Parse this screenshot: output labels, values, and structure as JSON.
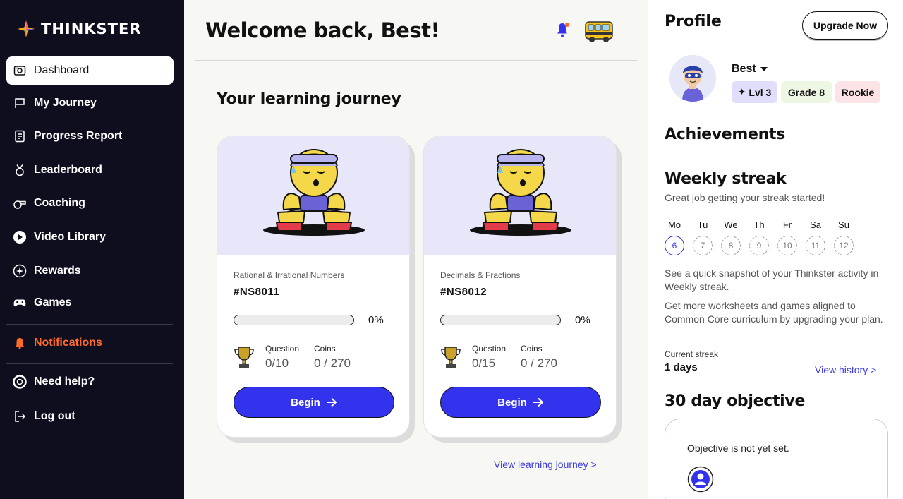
{
  "brand": {
    "name": "THINKSTER"
  },
  "sidebar": {
    "items": [
      {
        "label": "Dashboard",
        "icon": "dashboard-icon",
        "active": true
      },
      {
        "label": "My Journey",
        "icon": "flag-icon"
      },
      {
        "label": "Progress Report",
        "icon": "report-icon"
      },
      {
        "label": "Leaderboard",
        "icon": "medal-icon"
      },
      {
        "label": "Coaching",
        "icon": "whistle-icon"
      },
      {
        "label": "Video Library",
        "icon": "play-icon"
      },
      {
        "label": "Rewards",
        "icon": "rewards-icon"
      },
      {
        "label": "Games",
        "icon": "gamepad-icon"
      }
    ],
    "notifications": "Notifications",
    "help": "Need help?",
    "logout": "Log out"
  },
  "main": {
    "welcome": "Welcome back, Best!",
    "journey_title": "Your learning journey",
    "cards": [
      {
        "topic": "Rational & Irrational Numbers",
        "code": "#NS8011",
        "progress": 0,
        "progress_label": "0%",
        "question_label": "Question",
        "question_value": "0/10",
        "coins_label": "Coins",
        "coins_value": "0 / 270",
        "button": "Begin"
      },
      {
        "topic": "Decimals & Fractions",
        "code": "#NS8012",
        "progress": 0,
        "progress_label": "0%",
        "question_label": "Question",
        "question_value": "0/15",
        "coins_label": "Coins",
        "coins_value": "0 / 270",
        "button": "Begin"
      }
    ],
    "view_journey": "View learning journey >"
  },
  "profile": {
    "title": "Profile",
    "upgrade": "Upgrade Now",
    "name": "Best",
    "level": "Lvl 3",
    "grade": "Grade 8",
    "rank": "Rookie"
  },
  "achievements": {
    "title": "Achievements",
    "weekly_title": "Weekly streak",
    "weekly_sub": "Great job getting your streak started!",
    "days": [
      {
        "label": "Mo",
        "date": "6",
        "today": true
      },
      {
        "label": "Tu",
        "date": "7"
      },
      {
        "label": "We",
        "date": "8"
      },
      {
        "label": "Th",
        "date": "9"
      },
      {
        "label": "Fr",
        "date": "10"
      },
      {
        "label": "Sa",
        "date": "11"
      },
      {
        "label": "Su",
        "date": "12"
      }
    ],
    "snapshot": "See a quick snapshot of your Thinkster activity in Weekly streak.",
    "upsell": "Get more worksheets and games aligned to Common Core curriculum by upgrading your plan.",
    "current_streak_label": "Current streak",
    "current_streak_value": "1 days",
    "view_history": "View history >"
  },
  "objective": {
    "title": "30 day objective",
    "text": "Objective is not yet set."
  },
  "colors": {
    "accent": "#3333ee",
    "sidebar_bg": "#0f0e1f",
    "notification": "#ff6a2a"
  }
}
